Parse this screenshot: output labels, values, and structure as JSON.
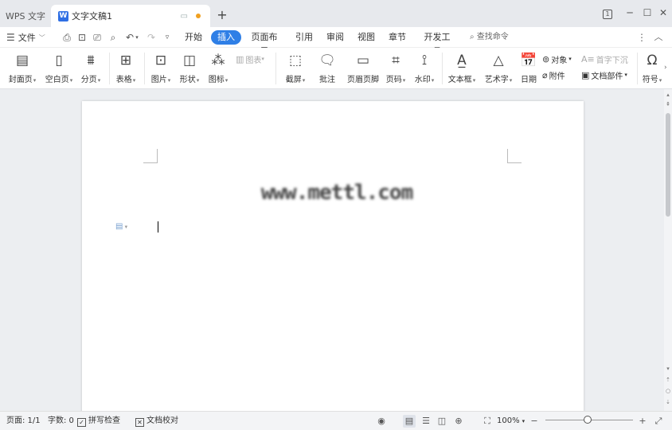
{
  "titlebar": {
    "app_tab": "WPS 文字",
    "doc_tab": "文字文稿1",
    "doc_logo": "W",
    "add_tab": "+",
    "badge": "1"
  },
  "menubar": {
    "file_label": "文件",
    "tabs": [
      "开始",
      "插入",
      "页面布局",
      "引用",
      "审阅",
      "视图",
      "章节",
      "开发工具"
    ],
    "active_tab": "插入",
    "search_placeholder": "查找命令"
  },
  "ribbon": {
    "cover_page": "封面页",
    "blank_page": "空白页",
    "page_break": "分页",
    "table": "表格",
    "picture": "图片",
    "shape": "形状",
    "icon": "图标",
    "chart": "图表",
    "screenshot": "截屏",
    "comment": "批注",
    "header_footer": "页眉页脚",
    "page_number": "页码",
    "watermark": "水印",
    "text_box": "文本框",
    "word_art": "艺术字",
    "date": "日期",
    "object": "对象",
    "attachment": "附件",
    "drop_cap": "首字下沉",
    "doc_parts": "文档部件",
    "symbol": "符号"
  },
  "document": {
    "watermark_text": "www.mettl.com"
  },
  "statusbar": {
    "page": "页面: 1/1",
    "word_count": "字数: 0",
    "spell_check": "拼写检查",
    "proofread": "文档校对",
    "zoom": "100%",
    "zoom_value": 1.0
  },
  "colors": {
    "accent": "#2f7fe6",
    "unsaved_dot": "#f0a020"
  }
}
